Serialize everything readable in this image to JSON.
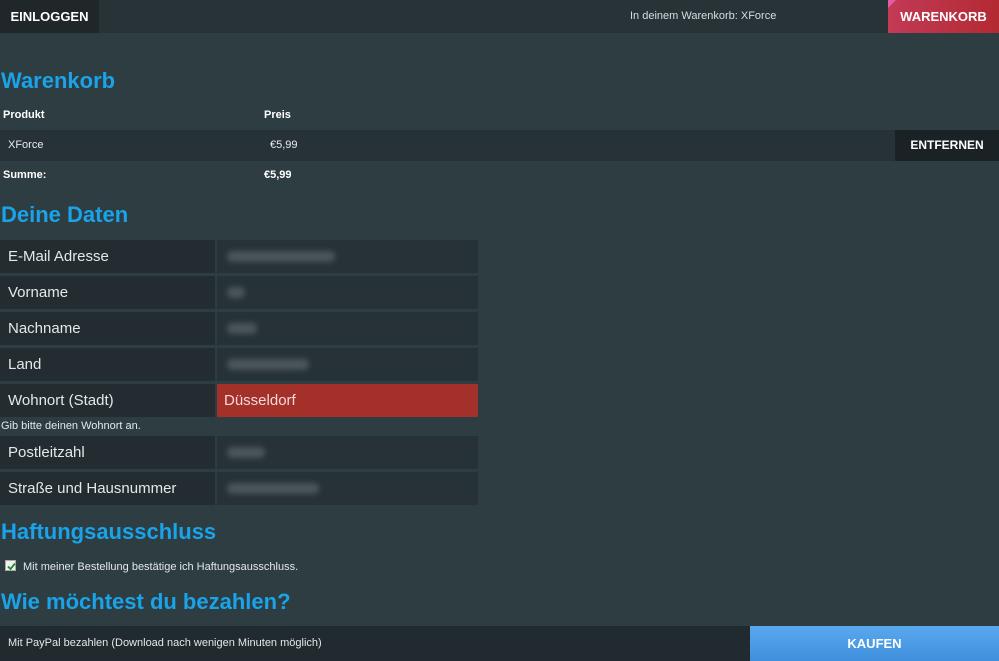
{
  "topbar": {
    "login_label": "EINLOGGEN",
    "cart_info": "In deinem Warenkorb: XForce",
    "cart_button": "WARENKORB"
  },
  "cart": {
    "heading": "Warenkorb",
    "columns": [
      "Produkt",
      "Preis"
    ],
    "items": [
      {
        "name": "XForce",
        "price": "€5,99",
        "remove_label": "ENTFERNEN"
      }
    ],
    "sum_label": "Summe:",
    "sum_value": "€5,99"
  },
  "details": {
    "heading": "Deine Daten",
    "fields": [
      {
        "label": "E-Mail Adresse"
      },
      {
        "label": "Vorname"
      },
      {
        "label": "Nachname"
      },
      {
        "label": "Land"
      },
      {
        "label": "Wohnort (Stadt)",
        "value": "Düsseldorf"
      },
      {
        "label": "Postleitzahl"
      },
      {
        "label": "Straße und Hausnummer"
      }
    ],
    "error_message": "Gib bitte deinen Wohnort an."
  },
  "disclaimer": {
    "heading": "Haftungsausschluss",
    "checkbox_label": "Mit meiner Bestellung bestätige ich Haftungsausschluss.",
    "checked": true
  },
  "payment": {
    "heading": "Wie möchtest du bezahlen?",
    "method_label": "Mit PayPal bezahlen (Download nach wenigen Minuten möglich)",
    "buy_label": "KAUFEN"
  },
  "colors": {
    "accent": "#1aa3e8",
    "error": "#a4302a",
    "cart_button": "#b32a33",
    "buy_button": "#4a9ae6"
  }
}
